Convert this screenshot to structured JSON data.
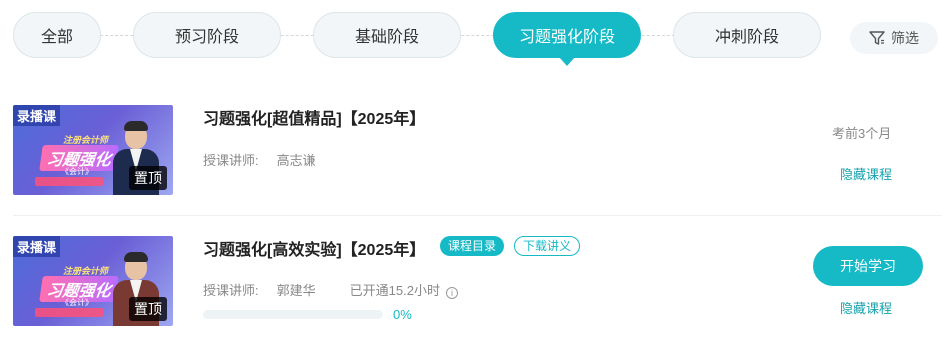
{
  "stages": {
    "all": "全部",
    "preview": "预习阶段",
    "basic": "基础阶段",
    "practice": "习题强化阶段",
    "sprint": "冲刺阶段",
    "active": "习题强化阶段"
  },
  "filter": {
    "label": "筛选",
    "icon": "filter-icon"
  },
  "courses": [
    {
      "thumb": {
        "badge": "录播课",
        "subtitle": "注册会计师",
        "headline": "习题强化",
        "caption": "《会计》",
        "pin": "置顶"
      },
      "title": "习题强化[超值精品]【2025年】",
      "teacher_label": "授课讲师:",
      "teacher": "高志谦",
      "meta_right": "考前3个月",
      "hide": "隐藏课程"
    },
    {
      "thumb": {
        "badge": "录播课",
        "subtitle": "注册会计师",
        "headline": "习题强化",
        "caption": "《会计》",
        "pin": "置顶"
      },
      "title": "习题强化[高效实验]【2025年】",
      "catalog": "课程目录",
      "download": "下载讲义",
      "teacher_label": "授课讲师:",
      "teacher": "郭建华",
      "hours": "已开通15.2小时",
      "progress_value": 0,
      "progress_text": "0%",
      "start": "开始学习",
      "hide": "隐藏课程"
    }
  ]
}
